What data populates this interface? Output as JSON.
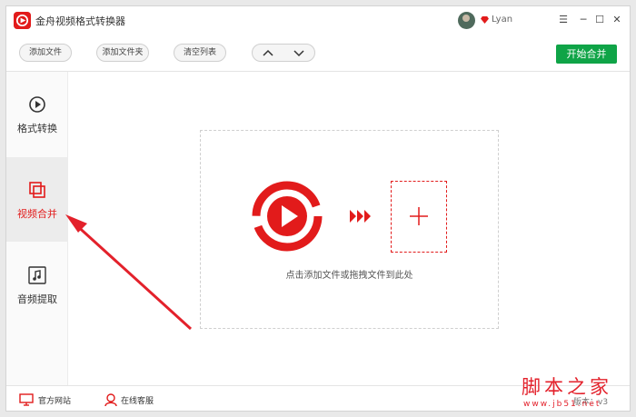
{
  "app": {
    "title": "金舟视频格式转换器",
    "username": "Lyan"
  },
  "window_controls": {
    "menu": "☰",
    "minimize": "─",
    "maximize": "☐",
    "close": "✕"
  },
  "toolbar": {
    "add_file": "添加文件",
    "add_folder": "添加文件夹",
    "clear_list": "清空列表",
    "up": "up-chevron-icon",
    "down": "down-chevron-icon",
    "start_merge": "开始合并"
  },
  "sidebar": {
    "items": [
      {
        "label": "格式转换",
        "icon": "format-convert-icon",
        "active": false
      },
      {
        "label": "视频合并",
        "icon": "video-merge-icon",
        "active": true
      },
      {
        "label": "音频提取",
        "icon": "music-note-icon",
        "active": false
      }
    ]
  },
  "main": {
    "drop_hint": "点击添加文件或拖拽文件到此处"
  },
  "footer": {
    "website": "官方网站",
    "support": "在线客服",
    "version": "版本：v3"
  },
  "watermark": {
    "big": "脚本之家",
    "small": "www.jb51.net"
  },
  "colors": {
    "brand_red": "#e21b1b",
    "merge_green": "#0fa447"
  }
}
